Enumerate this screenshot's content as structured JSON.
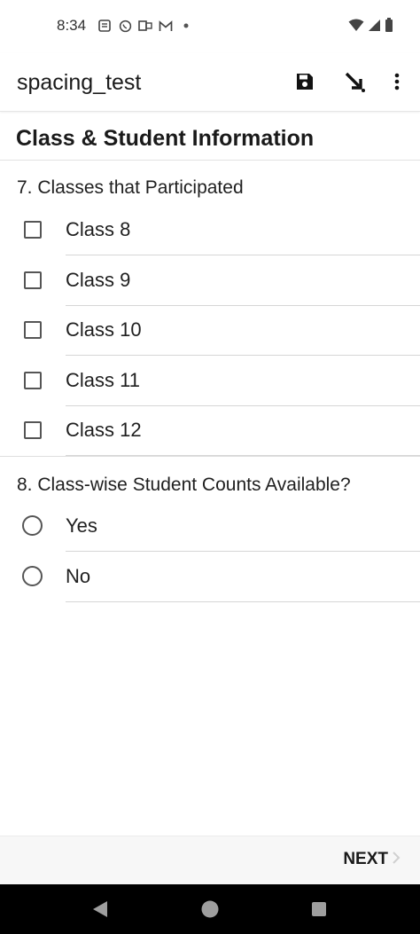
{
  "status_bar": {
    "time": "8:34",
    "left_icons": [
      "notification-icon",
      "whatsapp-icon",
      "outlook-icon",
      "gmail-icon",
      "dot-icon"
    ],
    "right_icons": [
      "wifi-icon",
      "signal-icon",
      "battery-icon"
    ]
  },
  "app_bar": {
    "title": "spacing_test",
    "actions": [
      "save-icon",
      "jump-icon",
      "more-vert-icon"
    ]
  },
  "section_title": "Class & Student Information",
  "questions": [
    {
      "label": "7. Classes that Participated",
      "type": "checkbox",
      "options": [
        "Class 8",
        "Class 9",
        "Class 10",
        "Class 11",
        "Class 12"
      ]
    },
    {
      "label": "8. Class-wise Student Counts Available?",
      "type": "radio",
      "options": [
        "Yes",
        "No"
      ]
    }
  ],
  "bottom_bar": {
    "next_label": "NEXT"
  },
  "colors": {
    "nav_bar": "#000000",
    "bottom_bar": "#f7f7f7"
  }
}
